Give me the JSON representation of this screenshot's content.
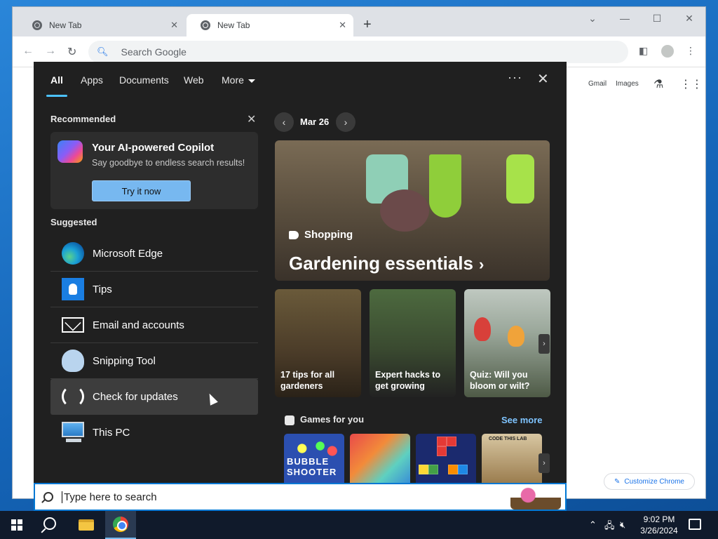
{
  "browser": {
    "tabs": [
      {
        "label": "New Tab",
        "active": false
      },
      {
        "label": "New Tab",
        "active": true
      }
    ],
    "omnibox_placeholder": "Search Google",
    "ntp_links": [
      "Gmail",
      "Images"
    ],
    "customize_label": "Customize Chrome"
  },
  "flyout": {
    "tabs": [
      "All",
      "Apps",
      "Documents",
      "Web",
      "More"
    ],
    "active_tab": "All",
    "recommended": {
      "title": "Recommended",
      "card_title": "Your AI-powered Copilot",
      "card_subtitle": "Say goodbye to endless search results!",
      "card_button": "Try it now"
    },
    "suggested": {
      "title": "Suggested",
      "items": [
        {
          "label": "Microsoft Edge",
          "icon": "edge-icon"
        },
        {
          "label": "Tips",
          "icon": "tips-icon"
        },
        {
          "label": "Email and accounts",
          "icon": "mail-icon"
        },
        {
          "label": "Snipping Tool",
          "icon": "snipping-tool-icon"
        },
        {
          "label": "Check for updates",
          "icon": "refresh-icon",
          "hover": true
        },
        {
          "label": "This PC",
          "icon": "computer-icon"
        }
      ]
    },
    "date": "Mar 26",
    "hero": {
      "tag": "Shopping",
      "title": "Gardening essentials"
    },
    "cards": [
      "17 tips for all gardeners",
      "Expert hacks to get growing",
      "Quiz: Will you bloom or wilt?"
    ],
    "games": {
      "title": "Games for you",
      "see_more": "See more",
      "tiles": [
        "BUBBLE SHOOTER",
        "",
        "",
        "CODE THIS LAB"
      ]
    }
  },
  "search_box": {
    "placeholder": "Type here to search"
  },
  "taskbar": {
    "time": "9:02 PM",
    "date": "3/26/2024"
  }
}
